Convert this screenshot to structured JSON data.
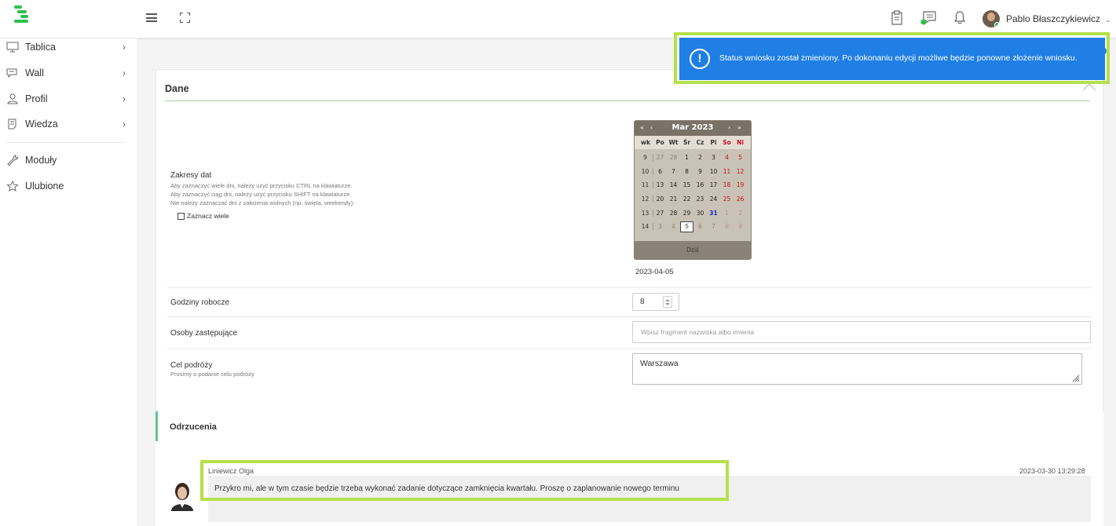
{
  "app": {
    "user_name": "Pablo Błaszczykiewicz"
  },
  "sidebar": {
    "items": [
      {
        "label": "Tablica",
        "icon": "monitor-icon",
        "has_arrow": true
      },
      {
        "label": "Wall",
        "icon": "chat-icon",
        "has_arrow": true
      },
      {
        "label": "Profil",
        "icon": "profile-icon",
        "has_arrow": true
      },
      {
        "label": "Wiedza",
        "icon": "book-icon",
        "has_arrow": true
      },
      {
        "label": "Moduły",
        "icon": "wrench-icon",
        "has_arrow": false
      },
      {
        "label": "Ulubione",
        "icon": "star-icon",
        "has_arrow": false
      }
    ]
  },
  "toast": {
    "message": "Status wniosku został zmieniony. Po dokonaniu edycji możliwe będzie ponowne złożenie wniosku.",
    "color": "#1f7fe5"
  },
  "form": {
    "section_title": "Dane",
    "date_ranges": {
      "label": "Zakresy dat",
      "hints": [
        "Aby zaznaczyć wiele dni, należy użyć przycisku CTRL na klawiaturze.",
        "Aby zaznaczyć ciąg dni, należy użyć przycisku SHIFT na klawiaturze.",
        "Nie należy zaznaczać dni z założenia wolnych (np. święta, weekendy)."
      ],
      "checkbox_label": "Zaznacz wiele",
      "checkbox_checked": false,
      "value": "2023-04-05"
    },
    "calendar": {
      "title": "Mar 2023",
      "nav": [
        "«",
        "‹",
        "›",
        "»"
      ],
      "headers": [
        "wk",
        "Po",
        "Wt",
        "Śr",
        "Cz",
        "Pi",
        "So",
        "Ni"
      ],
      "weeks": [
        {
          "wk": "9",
          "days": [
            "27",
            "28",
            "1",
            "2",
            "3",
            "4",
            "5"
          ]
        },
        {
          "wk": "10",
          "days": [
            "6",
            "7",
            "8",
            "9",
            "10",
            "11",
            "12"
          ]
        },
        {
          "wk": "11",
          "days": [
            "13",
            "14",
            "15",
            "16",
            "17",
            "18",
            "19"
          ]
        },
        {
          "wk": "12",
          "days": [
            "20",
            "21",
            "22",
            "23",
            "24",
            "25",
            "26"
          ]
        },
        {
          "wk": "13",
          "days": [
            "27",
            "28",
            "29",
            "30",
            "31",
            "1",
            "2"
          ]
        },
        {
          "wk": "14",
          "days": [
            "3",
            "4",
            "5",
            "6",
            "7",
            "8",
            "9"
          ]
        }
      ],
      "today_label": "Dziś",
      "highlighted_day": "31",
      "selected_day": "5"
    },
    "working_hours": {
      "label": "Godziny robocze",
      "value": "8"
    },
    "substitutes": {
      "label": "Osoby zastępujące",
      "placeholder": "Wpisz fragment nazwiska albo imienia"
    },
    "trip_purpose": {
      "label": "Cel podróży",
      "hint": "Prosimy o podanie celu podróży",
      "value": "Warszawa"
    }
  },
  "rejections": {
    "title": "Odrzucenia",
    "comment": {
      "author": "Liniewicz Olga",
      "date": "2023-03-30 13:29:28",
      "text": "Przykro mi, ale w tym czasie będzie trzeba wykonać zadanie dotyczące zamknięcia kwartału. Proszę o zaplanowanie nowego terminu"
    }
  },
  "colors": {
    "brand_green": "#2cc04a",
    "highlight": "#b5e04b",
    "section_accent": "#5ec78d"
  }
}
